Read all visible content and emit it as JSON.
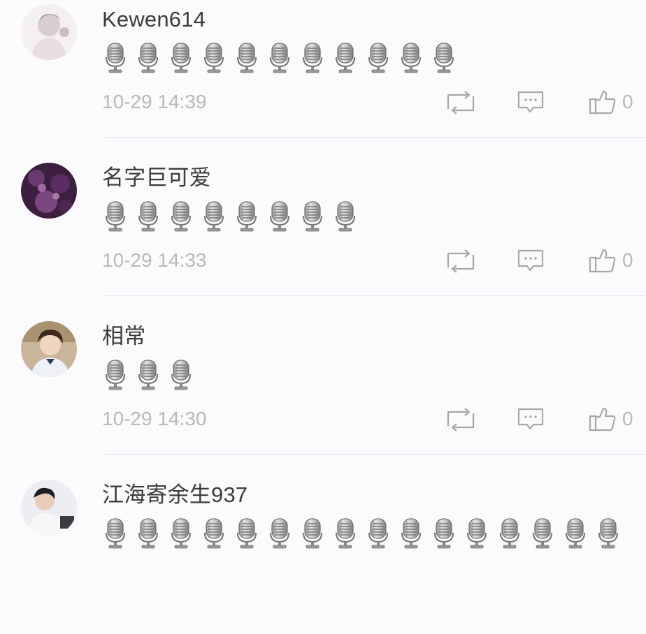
{
  "icons": {
    "content": "microphone-emoji",
    "repost": "repost-icon",
    "reply": "reply-icon",
    "like": "thumbs-up-icon"
  },
  "colors": {
    "background": "#fbfafd",
    "username": "#3c3c3c",
    "meta": "#b9b9b9",
    "divider": "#e6e5ea"
  },
  "comments": [
    {
      "username": "Kewen614",
      "mic_count": 11,
      "timestamp": "10-29 14:39",
      "like_count": "0"
    },
    {
      "username": "名字巨可爱",
      "mic_count": 8,
      "timestamp": "10-29 14:33",
      "like_count": "0"
    },
    {
      "username": "相常",
      "mic_count": 3,
      "timestamp": "10-29 14:30",
      "like_count": "0"
    },
    {
      "username": "江海寄余生937",
      "mic_count": 16
    }
  ]
}
